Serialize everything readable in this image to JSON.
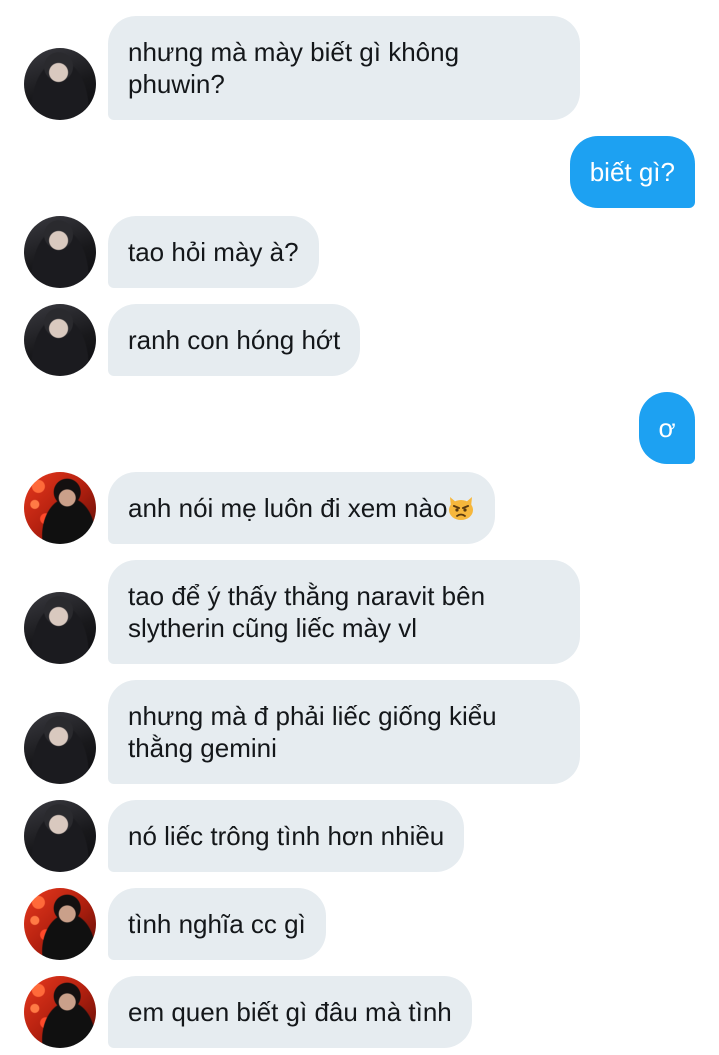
{
  "messages": [
    {
      "side": "in",
      "avatar": "dark",
      "text": "nhưng mà mày biết gì không\nphuwin?"
    },
    {
      "side": "out",
      "text": "biết gì?"
    },
    {
      "side": "in",
      "avatar": "dark",
      "text": "tao hỏi mày à?"
    },
    {
      "side": "in",
      "avatar": "dark",
      "text": "ranh con hóng hớt"
    },
    {
      "side": "out",
      "text": "ơ"
    },
    {
      "side": "in",
      "avatar": "red",
      "text": "anh nói mẹ luôn đi xem nào",
      "emoji": "pouting-cat-face"
    },
    {
      "side": "in",
      "avatar": "dark",
      "text": "tao để ý thấy thằng naravit bên\nslytherin cũng liếc mày vl"
    },
    {
      "side": "in",
      "avatar": "dark",
      "text": "nhưng mà đ phải liếc giống kiểu\nthằng gemini"
    },
    {
      "side": "in",
      "avatar": "dark",
      "text": "nó liếc trông tình hơn nhiều"
    },
    {
      "side": "in",
      "avatar": "red",
      "text": "tình nghĩa cc gì"
    },
    {
      "side": "in",
      "avatar": "red",
      "text": "em quen biết gì đâu mà tình"
    }
  ],
  "colors": {
    "incoming_bubble": "#e6ecf0",
    "outgoing_bubble": "#1da1f2",
    "incoming_text": "#14171a",
    "outgoing_text": "#ffffff"
  }
}
